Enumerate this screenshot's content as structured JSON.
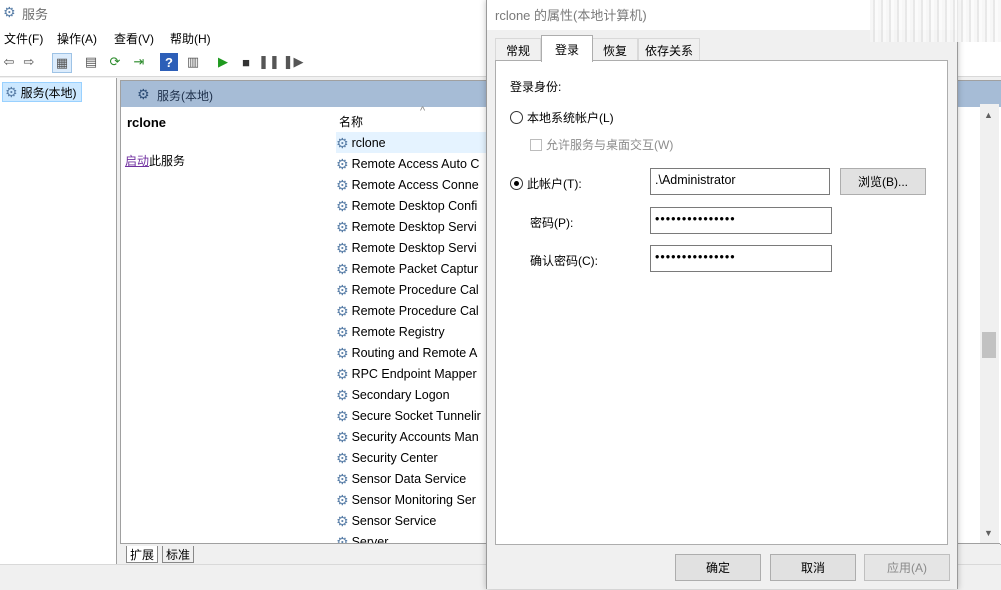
{
  "window": {
    "title": "服务"
  },
  "menu": [
    "文件(F)",
    "操作(A)",
    "查看(V)",
    "帮助(H)"
  ],
  "tree": {
    "root": "服务(本地)"
  },
  "content": {
    "header": "服务(本地)",
    "detail_title": "rclone",
    "start_link": "启动",
    "start_rest": "此服务",
    "column_name": "名称"
  },
  "services": [
    "rclone",
    "Remote Access Auto C",
    "Remote Access Conne",
    "Remote Desktop Confi",
    "Remote Desktop Servi",
    "Remote Desktop Servi",
    "Remote Packet Captur",
    "Remote Procedure Cal",
    "Remote Procedure Cal",
    "Remote Registry",
    "Routing and Remote A",
    "RPC Endpoint Mapper",
    "Secondary Logon",
    "Secure Socket Tunnelir",
    "Security Accounts Man",
    "Security Center",
    "Sensor Data Service",
    "Sensor Monitoring Ser",
    "Sensor Service",
    "Server"
  ],
  "bottom_tabs": [
    "扩展",
    "标准"
  ],
  "dialog": {
    "title": "rclone 的属性(本地计算机)",
    "tabs": [
      "常规",
      "登录",
      "恢复",
      "依存关系"
    ],
    "logon_as": "登录身份:",
    "local_system": "本地系统帐户(L)",
    "allow_desktop": "允许服务与桌面交互(W)",
    "this_account": "此帐户(T):",
    "account_value": ".\\Administrator",
    "browse": "浏览(B)...",
    "password_label": "密码(P):",
    "password_value": "•••••••••••••••",
    "confirm_label": "确认密码(C):",
    "confirm_value": "•••••••••••••••",
    "ok": "确定",
    "cancel": "取消",
    "apply": "应用(A)"
  }
}
